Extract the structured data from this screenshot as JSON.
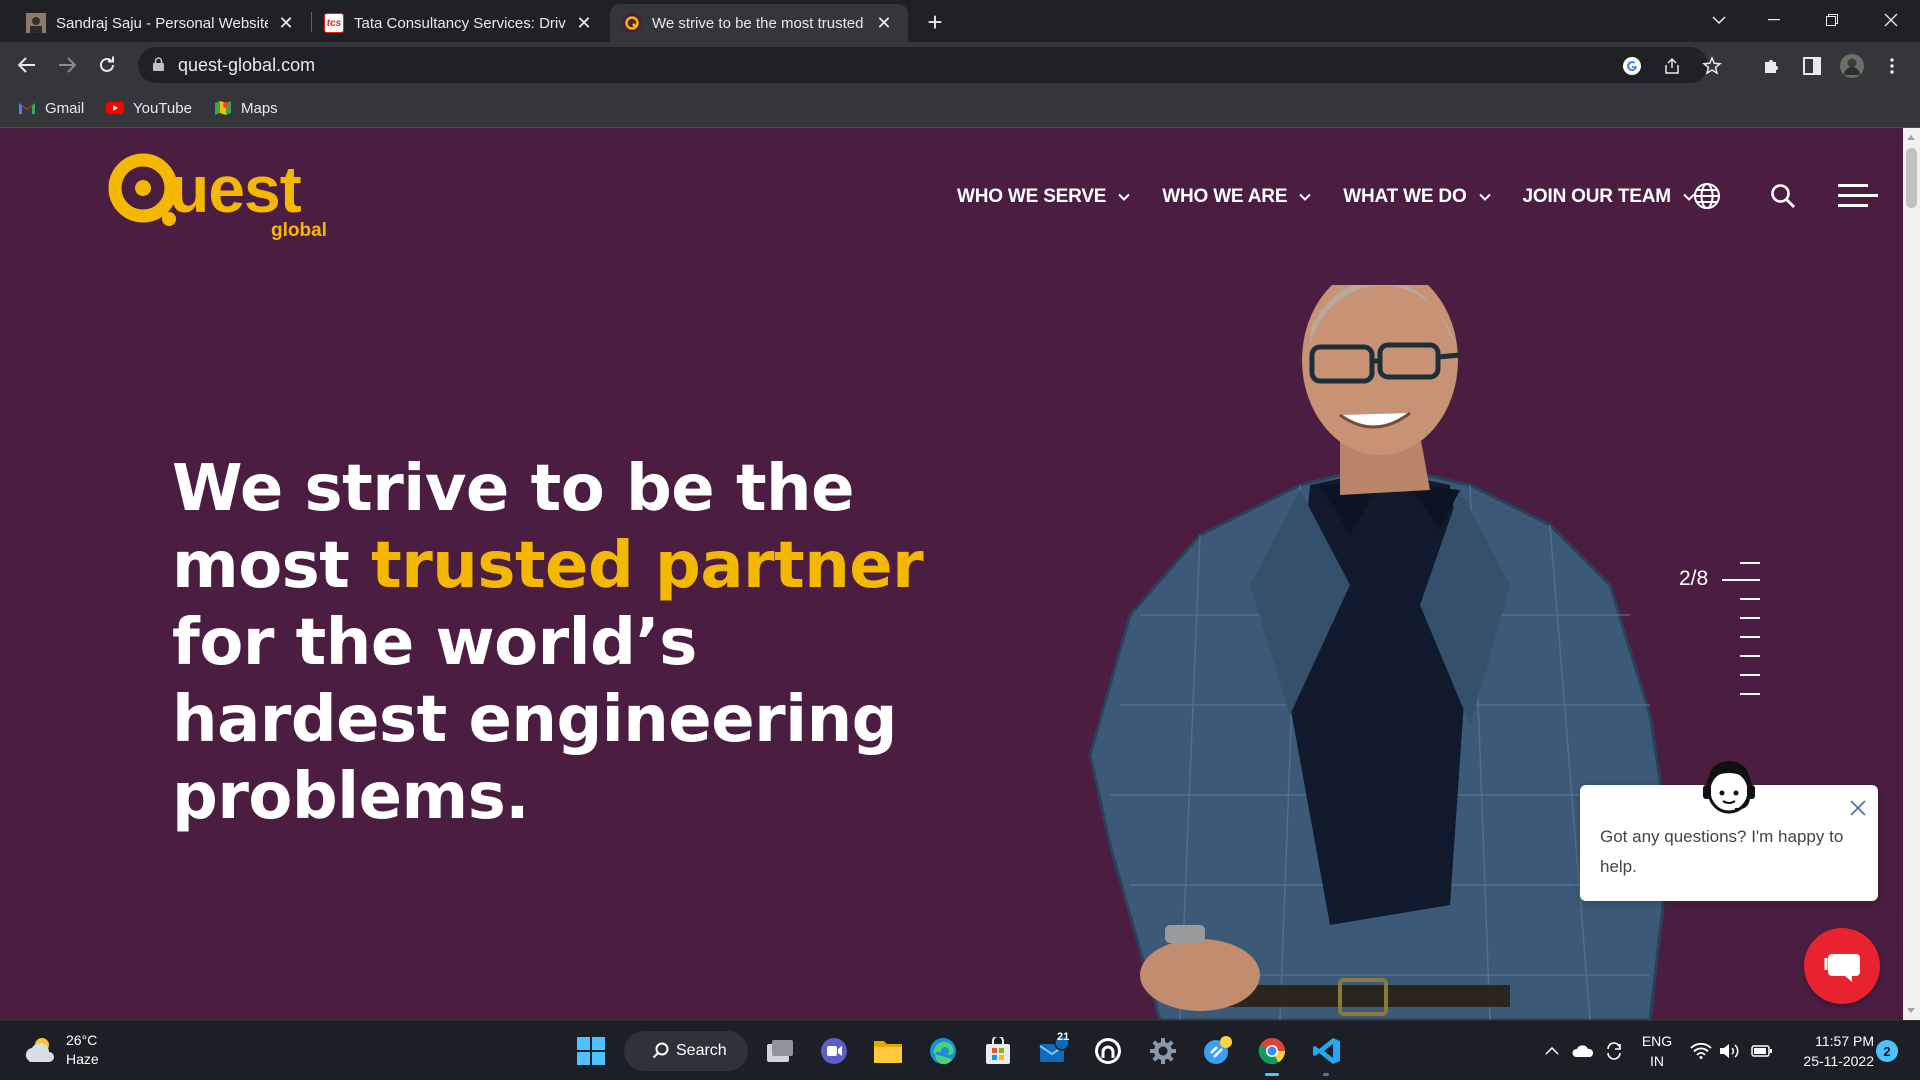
{
  "browser": {
    "tabs": [
      {
        "title": "Sandraj Saju - Personal Website",
        "active": false
      },
      {
        "title": "Tata Consultancy Services: Driving",
        "active": false
      },
      {
        "title": "We strive to be the most trusted",
        "active": true
      }
    ],
    "tab2_favicon_text": "tcs",
    "url": "quest-global.com",
    "bookmarks": [
      "Gmail",
      "YouTube",
      "Maps"
    ]
  },
  "site": {
    "logo": {
      "word": "uest",
      "sub": "global"
    },
    "nav": {
      "who_we_serve": "WHO WE SERVE",
      "who_we_are": "WHO WE ARE",
      "what_we_do": "WHAT WE DO",
      "join_our_team": "JOIN OUR TEAM"
    },
    "hero": {
      "line1": "We strive to be the",
      "line2_start": "most ",
      "line2_highlight": "trusted partner",
      "line3": "for the world’s",
      "line4": "hardest engineering",
      "line5": "problems."
    },
    "slider": {
      "indicator": "2/8",
      "current": 2,
      "total": 8
    },
    "chat": {
      "message": "Got any questions? I'm happy to help."
    }
  },
  "colors": {
    "brand_purple": "#4b1e41",
    "brand_yellow": "#f5b800",
    "chat_red": "#e8232f"
  },
  "taskbar": {
    "weather": {
      "temp": "26°C",
      "condition": "Haze"
    },
    "search_label": "Search",
    "mail_badge": "21",
    "language": {
      "line1": "ENG",
      "line2": "IN"
    },
    "clock": {
      "time": "11:57 PM",
      "date": "25-11-2022"
    },
    "notification_count": "2"
  }
}
